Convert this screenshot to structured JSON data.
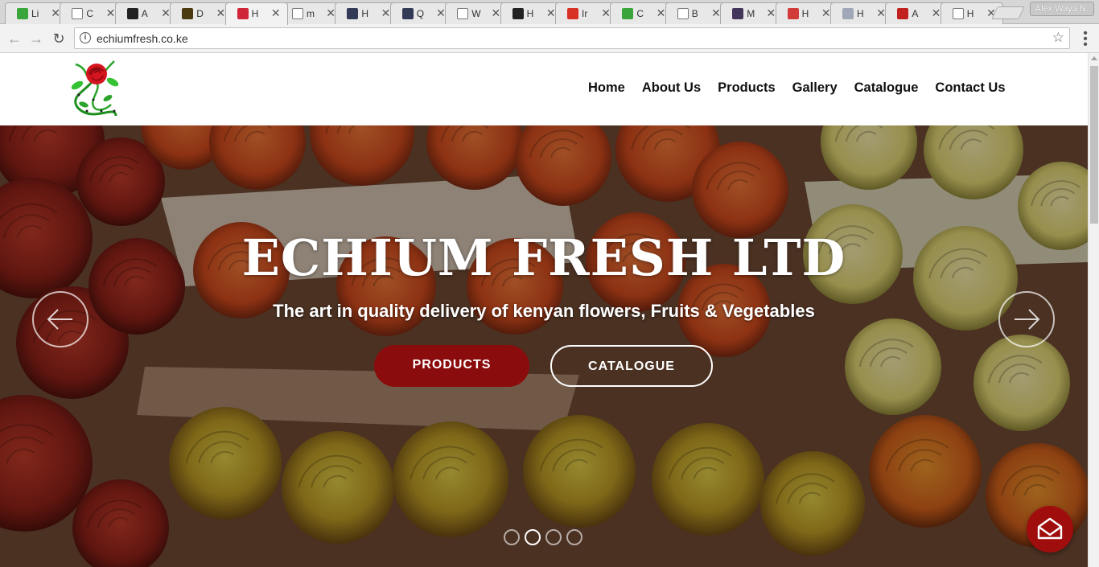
{
  "browser": {
    "tabs": [
      {
        "title": "Li",
        "favicon": "leaf-icon",
        "color": "#3aa53a"
      },
      {
        "title": "C",
        "favicon": "page-icon",
        "color": "#ffffff"
      },
      {
        "title": "A",
        "favicon": "dark-square-icon",
        "color": "#222222"
      },
      {
        "title": "D",
        "favicon": "dark-image-icon",
        "color": "#4b3a10"
      },
      {
        "title": "H",
        "favicon": "rose-icon",
        "color": "#d1263a",
        "active": true
      },
      {
        "title": "m",
        "favicon": "page-icon",
        "color": "#ffffff"
      },
      {
        "title": "H",
        "favicon": "stack-icon",
        "color": "#333a55"
      },
      {
        "title": "Q",
        "favicon": "stack-icon",
        "color": "#333a55"
      },
      {
        "title": "W",
        "favicon": "page-icon",
        "color": "#ffffff"
      },
      {
        "title": "H",
        "favicon": "github-icon",
        "color": "#222222"
      },
      {
        "title": "Ir",
        "favicon": "gmail-icon",
        "color": "#d93025"
      },
      {
        "title": "C",
        "favicon": "leaf-icon",
        "color": "#3aa53a"
      },
      {
        "title": "B",
        "favicon": "page-icon",
        "color": "#ffffff"
      },
      {
        "title": "M",
        "favicon": "avatar-icon",
        "color": "#44355a"
      },
      {
        "title": "H",
        "favicon": "puzzle-icon",
        "color": "#d33a3a"
      },
      {
        "title": "H",
        "favicon": "cloud-icon",
        "color": "#a0a8b8"
      },
      {
        "title": "A",
        "favicon": "news-icon",
        "color": "#c0201e"
      },
      {
        "title": "H",
        "favicon": "page-icon",
        "color": "#ffffff"
      }
    ],
    "profile_name": "Alex Waya N.",
    "url": "echiumfresh.co.ke"
  },
  "site": {
    "nav": [
      "Home",
      "About Us",
      "Products",
      "Gallery",
      "Catalogue",
      "Contact Us"
    ],
    "hero": {
      "title": "ECHIUM FRESH LTD",
      "subtitle": "The art in quality delivery of kenyan flowers, Fruits & Vegetables",
      "primary_button": "PRODUCTS",
      "secondary_button": "CATALOGUE",
      "slide_count": 4,
      "active_slide": 2
    },
    "colors": {
      "accent": "#8b0c0c",
      "fab": "#a00d0d"
    }
  }
}
